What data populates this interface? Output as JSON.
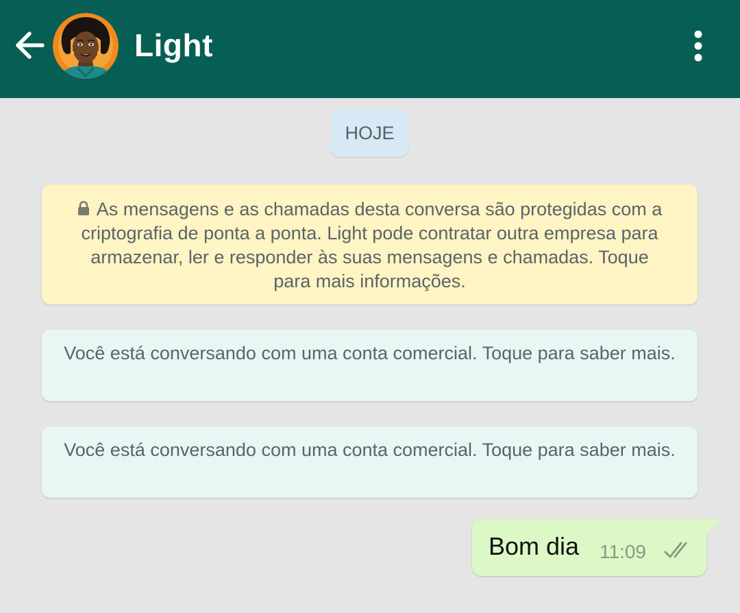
{
  "header": {
    "contact_name": "Light",
    "background_color": "#075e54",
    "icons": {
      "back": "arrow-left-icon",
      "menu": "more-vertical-icon"
    }
  },
  "chat": {
    "date_chip": "HOJE",
    "encryption_notice": {
      "icon": "lock-icon",
      "text": "As mensagens e as chamadas desta conversa são protegidas com a criptografia de ponta a ponta. Light pode contratar outra empresa para armazenar, ler e responder às suas mensagens e chamadas. Toque para mais informações."
    },
    "business_notices": [
      "Você está conversando com uma conta comercial. Toque para saber mais.",
      "Você está conversando com uma conta comercial. Toque para saber mais."
    ],
    "messages": [
      {
        "direction": "outgoing",
        "text": "Bom dia",
        "time": "11:09",
        "status": "delivered"
      }
    ]
  }
}
